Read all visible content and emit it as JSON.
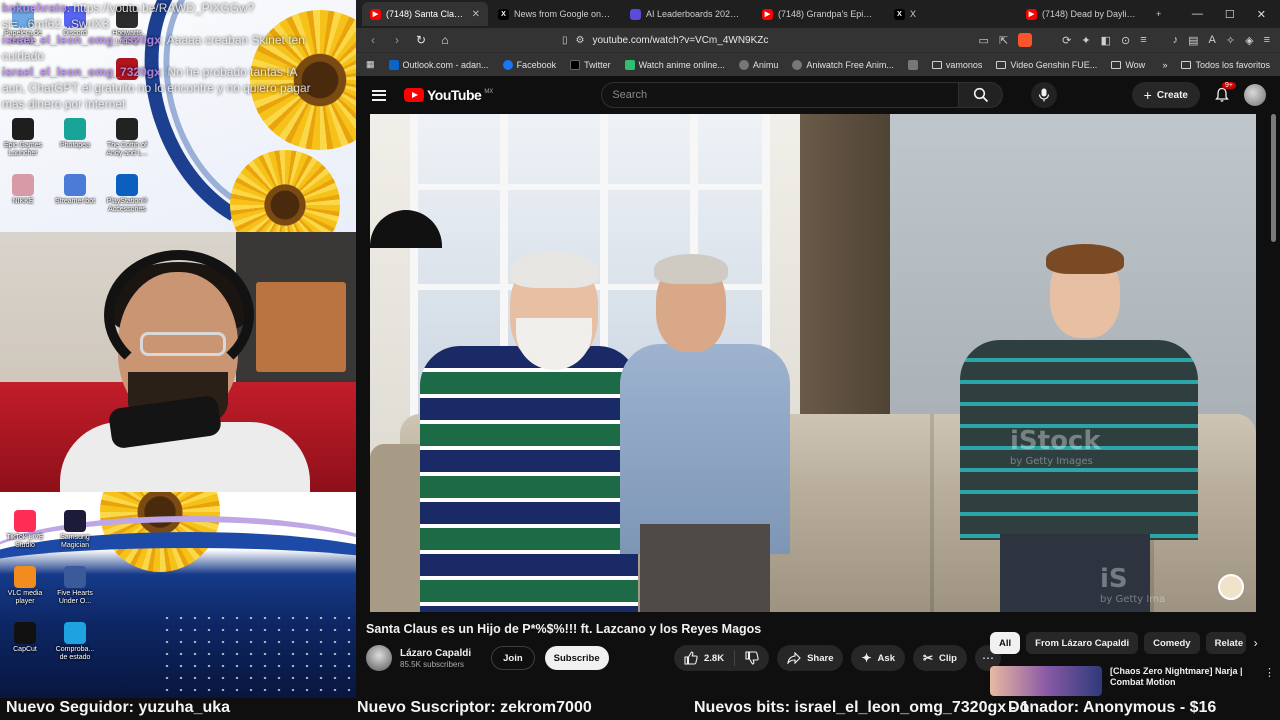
{
  "stream_overlay": {
    "chat": [
      {
        "user": "kokuehrato",
        "text": "https://youtu.be/RAWD_PlXGGw?si=...6mf62...SwrlX3",
        "user_color": "#b98ae8"
      },
      {
        "user": "israel_el_leon_omg_7320gx",
        "text": "Aaaaa creaban Skinet ten cuidado",
        "user_color": "#b98ae8"
      },
      {
        "user": "israel_el_leon_omg_7320gx",
        "text": "No he probado tantas IA aun, ChatGPT el gratuito no lo encontre y no quiero pagar mas dinero por internet",
        "user_color": "#b98ae8"
      }
    ],
    "desktop_icons_top": [
      {
        "label": "Papelera de reciclaje",
        "color": "#6fa9e6"
      },
      {
        "label": "Discord",
        "color": "#5865f2"
      },
      {
        "label": "Hogwarts Legacy",
        "color": "#2c2c2c"
      },
      {
        "label": "Epic Games Launcher",
        "color": "#1e1e1e"
      },
      {
        "label": "Photopea",
        "color": "#18a497"
      },
      {
        "label": "The Coffin of Andy and L...",
        "color": "#222222"
      },
      {
        "label": "NIKKE",
        "color": "#d99aa8"
      },
      {
        "label": "Streamer.bot",
        "color": "#4b7bd6"
      },
      {
        "label": "PlayStation® Accessories",
        "color": "#0b5fbf"
      }
    ],
    "desktop_icons_bottom": [
      {
        "label": "TikTok LIVE Studio",
        "color": "#ff2d55"
      },
      {
        "label": "Samsung Magician",
        "color": "#1c1c3a"
      },
      {
        "label": "VLC media player",
        "color": "#f28c1e"
      },
      {
        "label": "Five Hearts Under O...",
        "color": "#3a5a9a"
      },
      {
        "label": "CapCut",
        "color": "#111111"
      },
      {
        "label": "Comproba... de estado",
        "color": "#1fa3e0"
      }
    ]
  },
  "browser": {
    "tabs": [
      {
        "title": "(7148) Santa Claus es un Hij",
        "icon": "youtube-icon",
        "color": "#ff0000",
        "active": true
      },
      {
        "title": "News from Google on X: \"Ir",
        "icon": "x-icon",
        "color": "#000000",
        "active": false
      },
      {
        "title": "AI Leaderboards 2026 - Cor",
        "icon": "leaderboard-icon",
        "color": "#5b4bdb",
        "active": false
      },
      {
        "title": "(7148) Grandpa's Epic Spec",
        "icon": "youtube-icon",
        "color": "#ff0000",
        "active": false
      },
      {
        "title": "X",
        "icon": "x-icon",
        "color": "#000000",
        "active": false
      },
      {
        "title": "(7148) Dead by Daylight | S",
        "icon": "youtube-icon",
        "color": "#ff0000",
        "active": false
      }
    ],
    "new_tab": "+",
    "window_controls": [
      "—",
      "☐",
      "✕"
    ],
    "url": "youtube.com/watch?v=VCm_4WN9KZc",
    "bookmarks": [
      {
        "label": "Outlook.com - adan...",
        "color": "#0a64c9",
        "kind": "site"
      },
      {
        "label": "Facebook",
        "color": "#1877f2",
        "kind": "site"
      },
      {
        "label": "Twitter",
        "color": "#000000",
        "kind": "site"
      },
      {
        "label": "Watch anime online...",
        "color": "#2fbf71",
        "kind": "site"
      },
      {
        "label": "Animu",
        "color": "#777777",
        "kind": "site"
      },
      {
        "label": "Aniwatch Free Anim...",
        "color": "#777777",
        "kind": "site"
      },
      {
        "label": "",
        "color": "#777777",
        "kind": "site"
      },
      {
        "label": "vamonos",
        "color": "",
        "kind": "folder"
      },
      {
        "label": "Video Genshin FUE...",
        "color": "",
        "kind": "folder"
      },
      {
        "label": "Wow",
        "color": "",
        "kind": "folder"
      }
    ],
    "bookmarks_more": "»",
    "all_bookmarks": "Todos los favoritos"
  },
  "youtube": {
    "logo_word": "YouTube",
    "country": "MX",
    "search_placeholder": "Search",
    "create_label": "Create",
    "notifications_badge": "9+",
    "video": {
      "title": "Santa Claus es un Hijo de P*%$%!!! ft. Lazcano y los Reyes Magos",
      "channel": "Lázaro Capaldi",
      "subscribers": "85.5K subscribers",
      "join_label": "Join",
      "subscribe_label": "Subscribe",
      "likes": "2.8K",
      "share_label": "Share",
      "ask_label": "Ask",
      "clip_label": "Clip",
      "watermark_1": "iStock",
      "watermark_1_sub": "by Getty Images",
      "watermark_2": "iS",
      "watermark_2_sub": "by Getty Ima"
    },
    "chips": [
      {
        "label": "All",
        "active": true
      },
      {
        "label": "From Lázaro Capaldi",
        "active": false
      },
      {
        "label": "Comedy",
        "active": false
      },
      {
        "label": "Relate",
        "active": false
      }
    ],
    "recommendation": {
      "title": "[Chaos Zero Nightmare] Narja | Combat Motion"
    }
  },
  "ticker": {
    "follower": "Nuevo Seguidor: yuzuha_uka",
    "subscriber": "Nuevo Suscriptor: zekrom7000",
    "bits": "Nuevos bits: israel_el_leon_omg_7320gx - 1",
    "donor": "Donador: Anonymous - $16"
  }
}
